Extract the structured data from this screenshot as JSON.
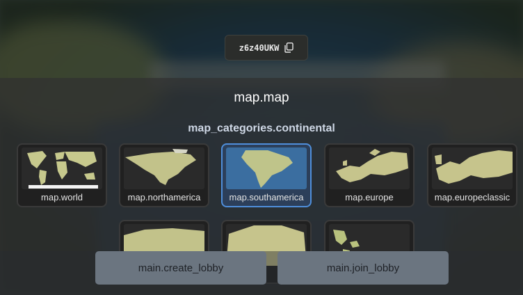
{
  "lobby": {
    "code": "z6z40UKW"
  },
  "modal": {
    "title": "map.map",
    "category": "map_categories.continental"
  },
  "maps": [
    {
      "label": "map.world",
      "selected": false,
      "thumb": "world"
    },
    {
      "label": "map.northamerica",
      "selected": false,
      "thumb": "northamerica"
    },
    {
      "label": "map.southamerica",
      "selected": true,
      "thumb": "southamerica"
    },
    {
      "label": "map.europe",
      "selected": false,
      "thumb": "europe"
    },
    {
      "label": "map.europeclassic",
      "selected": false,
      "thumb": "europeclassic"
    }
  ],
  "buttons": {
    "create_lobby": "main.create_lobby",
    "join_lobby": "main.join_lobby"
  },
  "colors": {
    "land": "#b9c27e",
    "selected_border": "#4f8fdc"
  }
}
